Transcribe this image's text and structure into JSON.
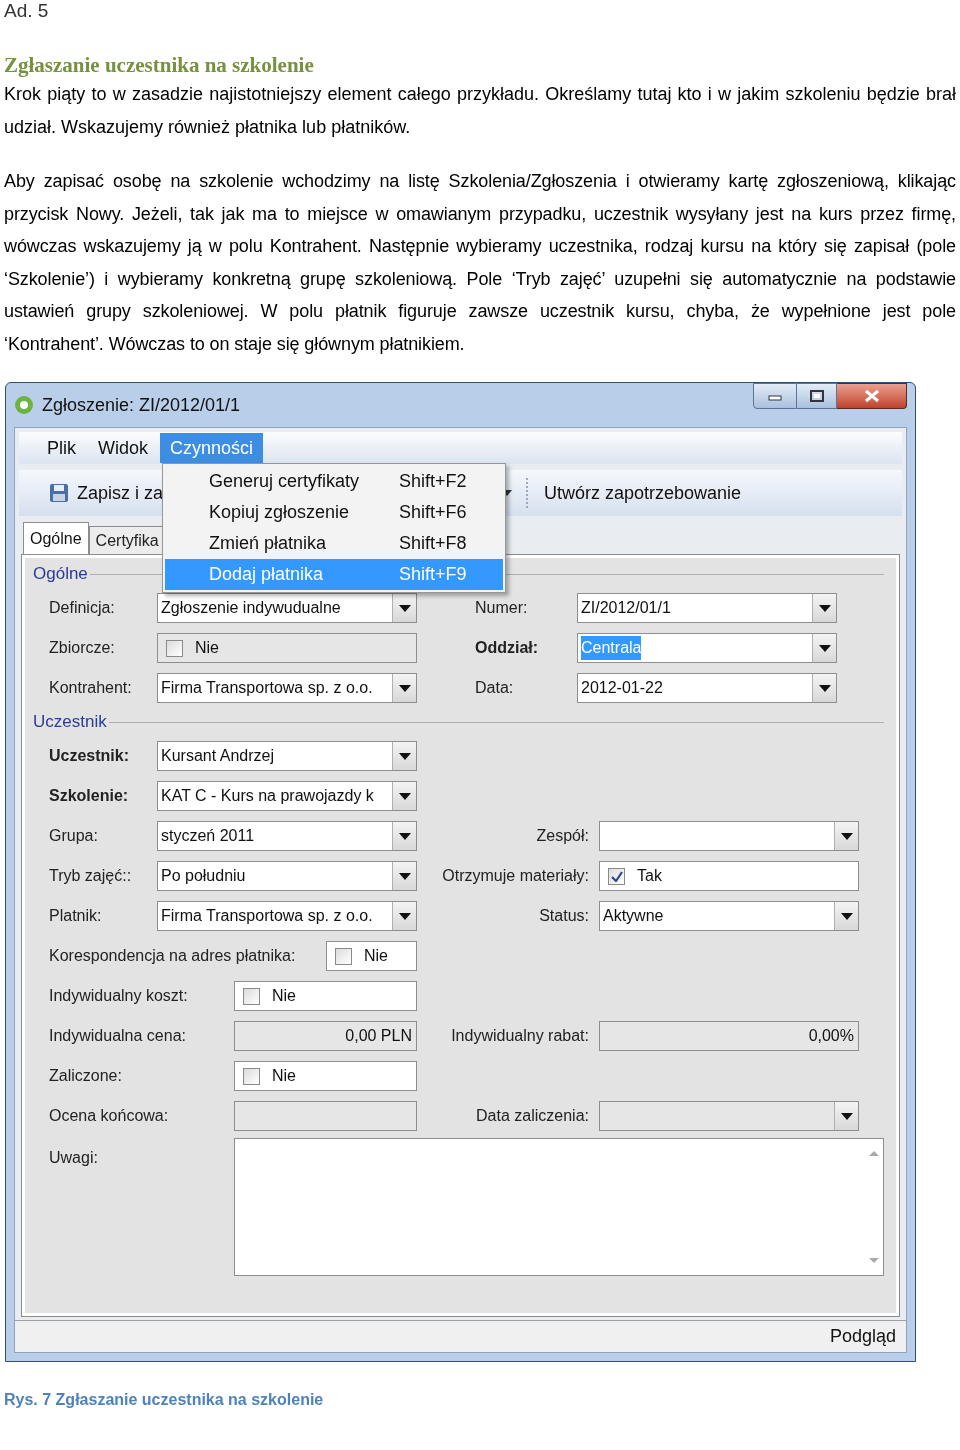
{
  "heading": "Ad. 5",
  "section_title": "Zgłaszanie uczestnika na szkolenie",
  "paragraphs": [
    "Krok piąty to w zasadzie najistotniejszy element całego przykładu. Określamy tutaj kto i w jakim szkoleniu będzie brał udział. Wskazujemy również płatnika lub płatników.",
    "Aby zapisać osobę na szkolenie wchodzimy na listę Szkolenia/Zgłoszenia i otwieramy kartę zgłoszeniową, klikając przycisk Nowy.  Jeżeli, tak  jak ma to miejsce w omawianym przypadku, uczestnik wysyłany jest na kurs przez firmę, wówczas wskazujemy ją w polu Kontrahent. Następnie wybieramy uczestnika, rodzaj kursu na który się zapisał (pole ‘Szkolenie’) i wybieramy konkretną grupę szkoleniową. Pole ‘Tryb zajęć’ uzupełni się automatycznie na podstawie ustawień  grupy szkoleniowej. W polu płatnik figuruje zawsze uczestnik  kursu, chyba, że wypełnione jest pole ‘Kontrahent’. Wówczas to on staje się głównym płatnikiem."
  ],
  "window": {
    "title": "Zgłoszenie: ZI/2012/01/1",
    "menu": [
      {
        "label": "Plik",
        "selected": false
      },
      {
        "label": "Widok",
        "selected": false
      },
      {
        "label": "Czynności",
        "selected": true
      }
    ],
    "toolbar": {
      "save_label": "Zapisz i za",
      "action_label": "Utwórz zapotrzebowanie"
    },
    "dropdown_menu": [
      {
        "label": "Generuj certyfikaty",
        "shortcut": "Shift+F2",
        "selected": false
      },
      {
        "label": "Kopiuj zgłoszenie",
        "shortcut": "Shift+F6",
        "selected": false
      },
      {
        "label": "Zmień płatnika",
        "shortcut": "Shift+F8",
        "selected": false
      },
      {
        "label": "Dodaj płatnika",
        "shortcut": "Shift+F9",
        "selected": true
      }
    ],
    "tabs": [
      {
        "label": "Ogólne",
        "selected": true
      },
      {
        "label": "Certyfika",
        "selected": false
      }
    ],
    "sections": [
      {
        "legend": "Ogólne",
        "rows": [
          {
            "left": {
              "label": "Definicja:",
              "bold": false,
              "kind": "combo",
              "value": "Zgłoszenie indywudualne",
              "disabled": false,
              "highlighted": false
            },
            "right": {
              "label": "Numer:",
              "bold": false,
              "kind": "combo",
              "value": "ZI/2012/01/1",
              "disabled": false,
              "highlighted": false
            }
          },
          {
            "left": {
              "label": "Zbiorcze:",
              "bold": false,
              "kind": "check",
              "value": "Nie",
              "checked": false,
              "disabled": true
            },
            "right": {
              "label": "Oddział:",
              "bold": true,
              "kind": "combo",
              "value": "Centrala",
              "disabled": false,
              "highlighted": true
            }
          },
          {
            "left": {
              "label": "Kontrahent:",
              "bold": false,
              "kind": "combo",
              "value": "Firma Transportowa sp. z o.o.",
              "disabled": false,
              "highlighted": false
            },
            "right": {
              "label": "Data:",
              "bold": false,
              "kind": "combo",
              "value": "2012-01-22",
              "disabled": false,
              "highlighted": false
            }
          }
        ]
      },
      {
        "legend": "Uczestnik",
        "rows": [
          {
            "left": {
              "label": "Uczestnik:",
              "bold": true,
              "kind": "combo",
              "value": "Kursant Andrzej",
              "disabled": false,
              "highlighted": false
            }
          },
          {
            "left": {
              "label": "Szkolenie:",
              "bold": true,
              "kind": "combo",
              "value": "KAT C - Kurs na prawojazdy k",
              "disabled": false,
              "highlighted": false
            }
          },
          {
            "left": {
              "label": "Grupa:",
              "bold": false,
              "kind": "combo",
              "value": "styczeń 2011",
              "disabled": false,
              "highlighted": false
            },
            "right": {
              "label": "Zespół:",
              "bold": false,
              "kind": "combo",
              "disabled": false
            }
          },
          {
            "left": {
              "label": "Tryb zajęć::",
              "bold": false,
              "kind": "combo",
              "value": "Po południu",
              "disabled": false,
              "highlighted": false
            },
            "right": {
              "label": "Otrzymuje materiały:",
              "bold": false,
              "kind": "check",
              "value": "Tak",
              "checked": true,
              "disabled": false
            }
          },
          {
            "left": {
              "label": "Platnik:",
              "bold": false,
              "kind": "combo",
              "value": "Firma Transportowa sp. z o.o.",
              "disabled": false,
              "highlighted": false
            },
            "right": {
              "label": "Status:",
              "bold": false,
              "kind": "combo",
              "value": "Aktywne",
              "disabled": false,
              "highlighted": false
            }
          },
          {
            "left": {
              "label": "Korespondencja na adres płatnika:",
              "bold": false,
              "kind": "check",
              "value": "Nie",
              "checked": false,
              "disabled": false
            }
          },
          {
            "left": {
              "label": "Indywidualny koszt:",
              "bold": false,
              "kind": "check",
              "value": "Nie",
              "checked": false,
              "disabled": false
            }
          },
          {
            "left": {
              "label": "Indywidualna cena:",
              "bold": false,
              "kind": "text",
              "value": "0,00 PLN",
              "disabled": true
            },
            "right": {
              "label": "Indywidualny rabat:",
              "bold": false,
              "kind": "text",
              "value": "0,00%",
              "disabled": true
            }
          },
          {
            "left": {
              "label": "Zaliczone:",
              "bold": false,
              "kind": "check",
              "value": "Nie",
              "checked": false,
              "disabled": false
            }
          },
          {
            "left": {
              "label": "Ocena końcowa:",
              "bold": false,
              "kind": "text",
              "disabled": true
            },
            "right": {
              "label": "Data zaliczenia:",
              "bold": false,
              "kind": "combo",
              "disabled": true
            }
          },
          {
            "left": {
              "label": "Uwagi:",
              "bold": false,
              "kind": "memo",
              "disabled": false
            }
          }
        ]
      }
    ],
    "status_bar": "Podgląd"
  },
  "caption": "Rys. 7 Zgłaszanie uczestnika na szkolenie"
}
